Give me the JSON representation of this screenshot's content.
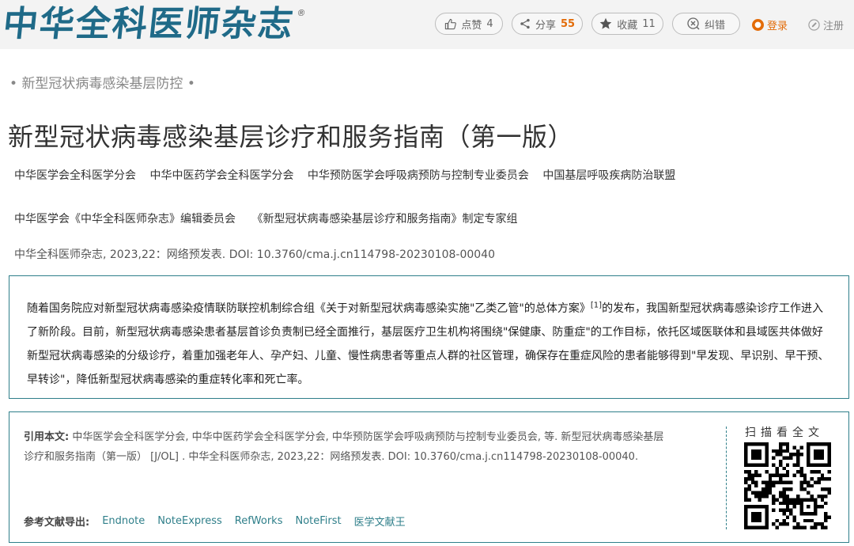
{
  "header": {
    "logo": "中华全科医师杂志",
    "logo_mark": "®",
    "like_label": "点赞",
    "like_count": "4",
    "share_label": "分享",
    "share_count": "55",
    "fav_label": "收藏",
    "fav_count": "11",
    "error_label": "纠错",
    "login_label": "登录",
    "register_label": "注册"
  },
  "article": {
    "column": "新型冠状病毒感染基层防控",
    "column_bullet": "•",
    "title": "新型冠状病毒感染基层诊疗和服务指南（第一版）",
    "authors_line1": [
      "中华医学会全科医学分会",
      "中华中医药学会全科医学分会",
      "中华预防医学会呼吸病预防与控制专业委员会",
      "中国基层呼吸疾病防治联盟"
    ],
    "authors_line2": [
      "中华医学会《中华全科医师杂志》编辑委员会",
      "《新型冠状病毒感染基层诊疗和服务指南》制定专家组"
    ],
    "source": "中华全科医师杂志, 2023,22：网络预发表. DOI: 10.3760/cma.j.cn114798-20230108-00040"
  },
  "abstract": {
    "before_ref": "随着国务院应对新型冠状病毒感染疫情联防联控机制综合组《关于对新型冠状病毒感染实施\"乙类乙管\"的总体方案》",
    "ref": "[1]",
    "after_ref": "的发布，我国新型冠状病毒感染诊疗工作进入了新阶段。目前，新型冠状病毒感染患者基层首诊负责制已经全面推行，基层医疗卫生机构将围绕\"保健康、防重症\"的工作目标，依托区域医联体和县域医共体做好新型冠状病毒感染的分级诊疗，着重加强老年人、孕产妇、儿童、慢性病患者等重点人群的社区管理，确保存在重症风险的患者能够得到\"早发现、早识别、早干预、早转诊\"，降低新型冠状病毒感染的重症转化率和死亡率。"
  },
  "citation": {
    "label": "引用本文:",
    "text": "中华医学会全科医学分会, 中华中医药学会全科医学分会, 中华预防医学会呼吸病预防与控制专业委员会, 等. 新型冠状病毒感染基层诊疗和服务指南（第一版） [J/OL] . 中华全科医师杂志, 2023,22：网络预发表. DOI: 10.3760/cma.j.cn114798-20230108-00040.",
    "export_label": "参考文献导出:",
    "export_links": [
      "Endnote",
      "NoteExpress",
      "RefWorks",
      "NoteFirst",
      "医学文献王"
    ],
    "qr_label": "扫描看全文"
  },
  "colors": {
    "accent": "#2f7f8a",
    "logo": "#1f6a88",
    "highlight": "#e36c09"
  }
}
